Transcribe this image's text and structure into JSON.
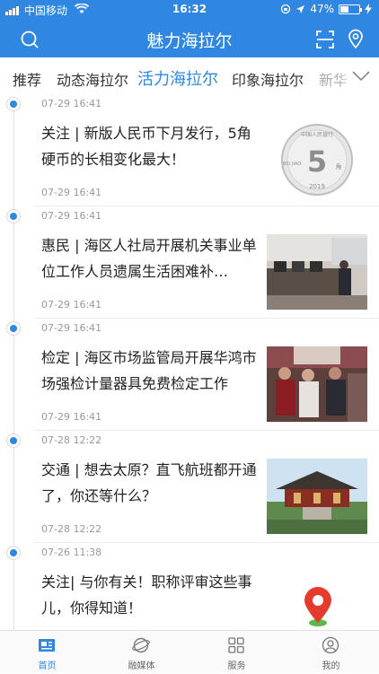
{
  "status": {
    "carrier": "中国移动",
    "time": "16:32",
    "battery": "47%",
    "battery_level": 0.47
  },
  "header": {
    "title": "魅力海拉尔"
  },
  "tabs": [
    {
      "label": "推荐",
      "active": false
    },
    {
      "label": "动态海拉尔",
      "active": false
    },
    {
      "label": "活力海拉尔",
      "active": true
    },
    {
      "label": "印象海拉尔",
      "active": false
    },
    {
      "label": "新华",
      "active": false
    }
  ],
  "feed": [
    {
      "time_top": "07-29 16:41",
      "headline": "关注 | 新版人民币下月发行，5角硬币的长相变化最大！",
      "time_bottom": "07-29 16:41",
      "thumb": "coin",
      "coin_text": [
        "中国人民银行",
        "5",
        "角",
        "WU JIAO",
        "2019"
      ]
    },
    {
      "time_top": "07-29 16:41",
      "headline": "惠民 | 海区人社局开展机关事业单位工作人员遗属生活困难补…",
      "time_bottom": "07-29 16:41",
      "thumb": "office"
    },
    {
      "time_top": "07-29 16:41",
      "headline": "检定 | 海区市场监管局开展华鸿市场强检计量器具免费检定工作",
      "time_bottom": "07-29 16:41",
      "thumb": "market"
    },
    {
      "time_top": "07-28 12:22",
      "headline": "交通 | 想去太原？直飞航班都开通了，你还等什么？",
      "time_bottom": "07-28 12:22",
      "thumb": "temple"
    },
    {
      "time_top": "07-26 11:38",
      "headline": "关注| 与你有关！职称评审这些事儿，你得知道！",
      "time_bottom": "",
      "thumb": "none"
    }
  ],
  "bottom_nav": [
    {
      "label": "首页",
      "icon": "home-news-icon",
      "active": true
    },
    {
      "label": "融媒体",
      "icon": "media-planet-icon",
      "active": false
    },
    {
      "label": "服务",
      "icon": "grid-service-icon",
      "active": false
    },
    {
      "label": "我的",
      "icon": "user-profile-icon",
      "active": false
    }
  ],
  "colors": {
    "brand": "#2f87e1",
    "pin": "#e53b2c",
    "pin_base": "#5bb84a"
  }
}
